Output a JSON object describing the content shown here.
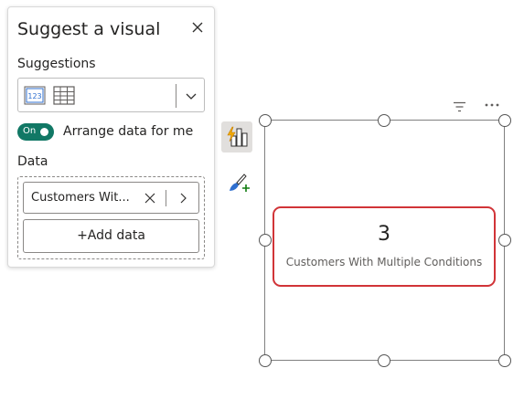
{
  "panel": {
    "title": "Suggest a visual",
    "suggestions_label": "Suggestions",
    "suggestion_icons": [
      "card-icon",
      "table-icon"
    ],
    "toggle": {
      "state_text": "On",
      "label": "Arrange data for me",
      "on": true
    },
    "data_label": "Data",
    "field": {
      "name": "Customers Wit..."
    },
    "add_data_label": "+Add data"
  },
  "tools": [
    "build-visual-icon",
    "format-visual-icon"
  ],
  "visual": {
    "card_value": "3",
    "card_label": "Customers With Multiple Conditions"
  },
  "colors": {
    "toggle_on": "#117865",
    "highlight_border": "#d13438",
    "accent_blue": "#2f6fcf"
  }
}
